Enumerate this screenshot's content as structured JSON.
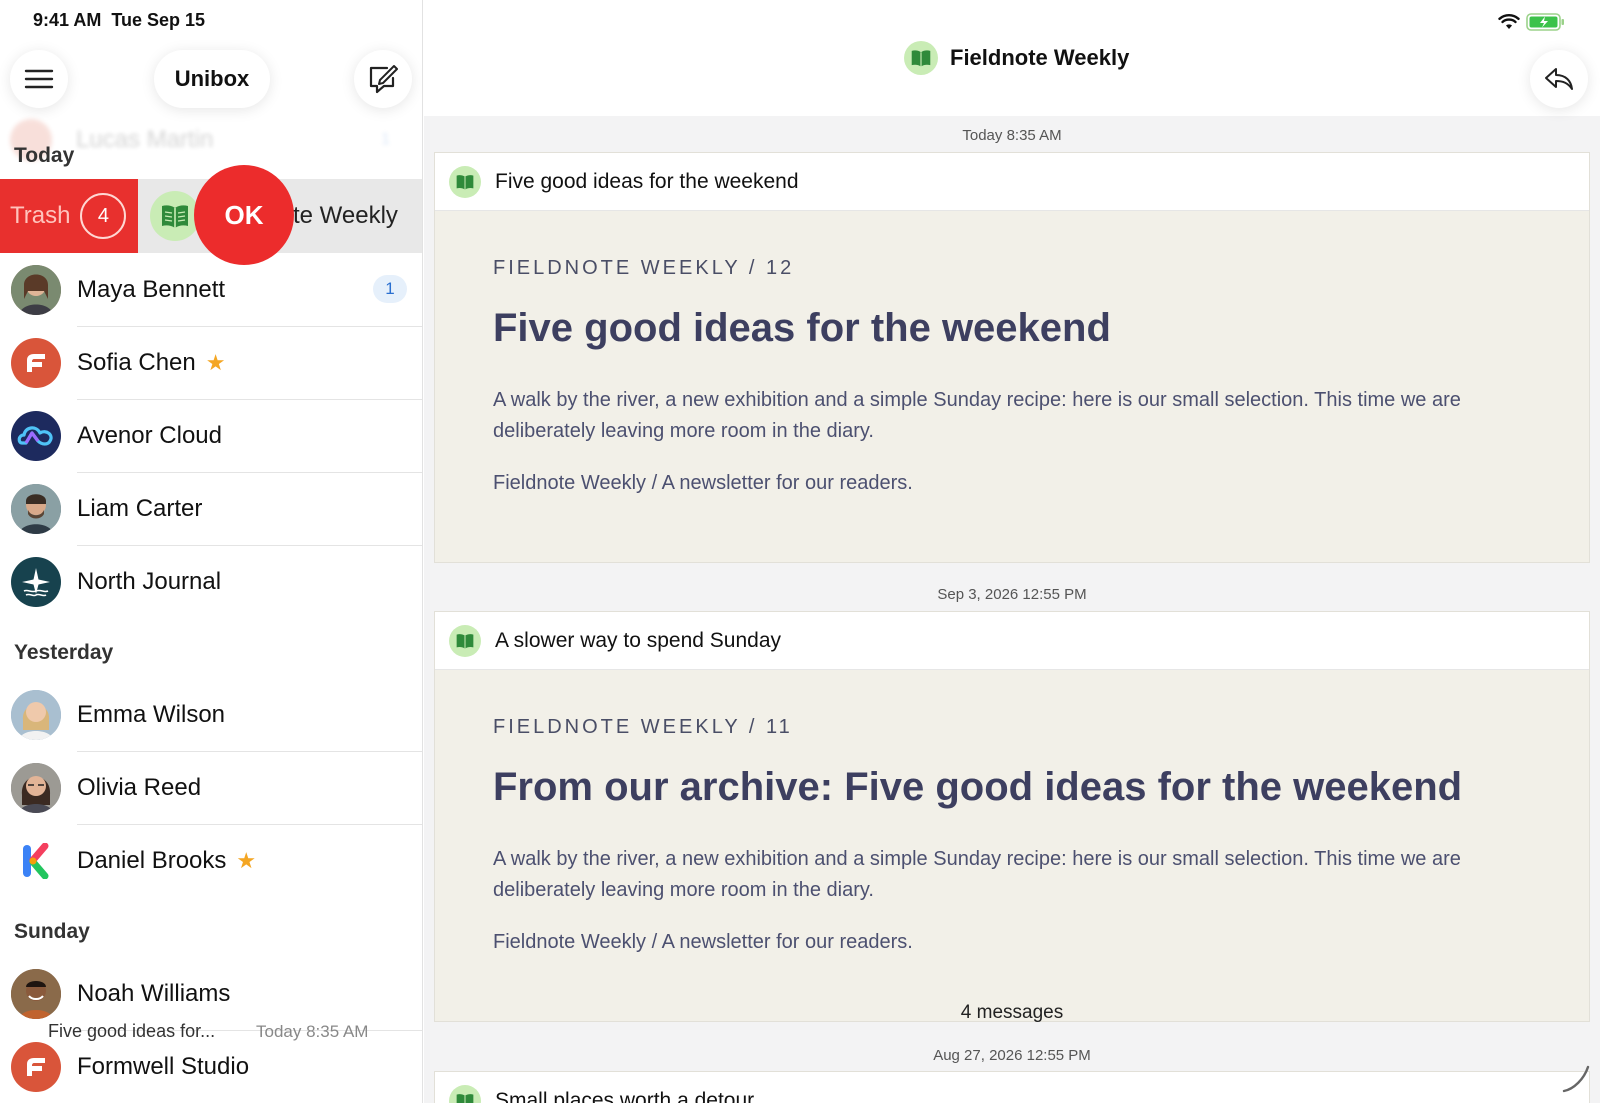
{
  "status": {
    "time": "9:41 AM",
    "date": "Tue Sep 15"
  },
  "sidebar": {
    "title": "Unibox",
    "ghost_row": {
      "name": "Lucas Martin",
      "badge": "1"
    },
    "sections": {
      "today": "Today",
      "yesterday": "Yesterday",
      "sunday": "Sunday"
    },
    "swipe": {
      "trash_label": "Trash",
      "trash_count": "4",
      "ok_label": "OK",
      "name_fragment": "te Weekly"
    },
    "today": [
      {
        "name": "Maya Bennett",
        "badge": "1"
      },
      {
        "name": "Sofia Chen",
        "starred": true
      },
      {
        "name": "Avenor Cloud"
      },
      {
        "name": "Liam Carter"
      },
      {
        "name": "North Journal"
      }
    ],
    "yesterday": [
      {
        "name": "Emma Wilson"
      },
      {
        "name": "Olivia Reed"
      },
      {
        "name": "Daniel Brooks",
        "starred": true
      }
    ],
    "sunday": [
      {
        "name": "Noah Williams"
      },
      {
        "name": "Formwell Studio"
      }
    ],
    "preview": {
      "subject": "Five good ideas for...",
      "time": "Today 8:35 AM"
    }
  },
  "detail": {
    "title": "Fieldnote Weekly",
    "messages": [
      {
        "date": "Today 8:35 AM",
        "subject": "Five good ideas for the weekend",
        "kicker": "FIELDNOTE WEEKLY / 12",
        "headline": "Five good ideas for the weekend",
        "body": "A walk by the river, a new exhibition and a simple Sunday recipe: here is our small selection. This time we are deliberately leaving more room in the diary.",
        "footer": "Fieldnote Weekly / A newsletter for our readers."
      },
      {
        "date": "Sep 3, 2026 12:55 PM",
        "subject": "A slower way to spend Sunday",
        "kicker": "FIELDNOTE WEEKLY / 11",
        "headline": "From our archive: Five good ideas for the weekend",
        "body": "A walk by the river, a new exhibition and a simple Sunday recipe: here is our small selection. This time we are deliberately leaving more room in the diary.",
        "footer": "Fieldnote Weekly / A newsletter for our readers."
      }
    ],
    "count_label": "4 messages",
    "third": {
      "date": "Aug 27, 2026 12:55 PM",
      "subject": "Small places worth a detour"
    }
  },
  "colors": {
    "accent_red": "#ec2c2c",
    "trash_red": "#e8302e",
    "badge_blue": "#2a6fd0",
    "newsletter_bg": "#f2f0e8",
    "headline": "#3d3f60",
    "star": "#f4a623"
  },
  "icons": [
    "menu-icon",
    "compose-icon",
    "reply-icon",
    "wifi-icon",
    "battery-icon",
    "book-logo-icon",
    "star-icon"
  ]
}
